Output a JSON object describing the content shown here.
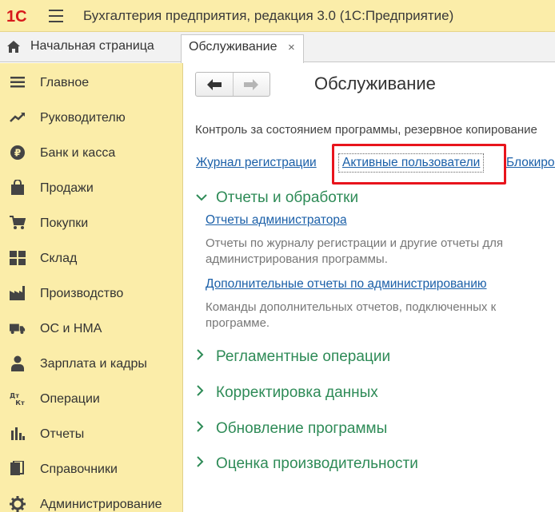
{
  "app": {
    "logo_text": "1С",
    "title": "Бухгалтерия предприятия, редакция 3.0   (1С:Предприятие)"
  },
  "tabs": {
    "home_label": "Начальная страница",
    "active_label": "Обслуживание",
    "close_glyph": "×"
  },
  "sidebar": {
    "items": [
      {
        "label": "Главное",
        "icon": "list-icon"
      },
      {
        "label": "Руководителю",
        "icon": "trend-icon"
      },
      {
        "label": "Банк и касса",
        "icon": "ruble-coin-icon"
      },
      {
        "label": "Продажи",
        "icon": "shopping-bag-icon"
      },
      {
        "label": "Покупки",
        "icon": "cart-icon"
      },
      {
        "label": "Склад",
        "icon": "warehouse-grid-icon"
      },
      {
        "label": "Производство",
        "icon": "factory-icon"
      },
      {
        "label": "ОС и НМА",
        "icon": "truck-icon"
      },
      {
        "label": "Зарплата и кадры",
        "icon": "person-icon"
      },
      {
        "label": "Операции",
        "icon": "debit-credit-icon"
      },
      {
        "label": "Отчеты",
        "icon": "bar-chart-icon"
      },
      {
        "label": "Справочники",
        "icon": "books-icon"
      },
      {
        "label": "Администрирование",
        "icon": "gear-icon"
      }
    ]
  },
  "main": {
    "title": "Обслуживание",
    "description": "Контроль за состоянием программы, резервное копирование",
    "links": {
      "journal": "Журнал регистрации",
      "active_users": "Активные пользователи",
      "blocking": "Блокировка"
    },
    "sections": [
      {
        "label": "Отчеты и обработки",
        "expanded": true,
        "items": [
          {
            "link": "Отчеты администратора",
            "desc_line1": "Отчеты по журналу регистрации и другие отчеты для",
            "desc_line2": "администрирования программы."
          },
          {
            "link": "Дополнительные отчеты по администрированию",
            "desc_line1": "Команды дополнительных отчетов, подключенных к",
            "desc_line2": "программе."
          }
        ]
      },
      {
        "label": "Регламентные операции",
        "expanded": false
      },
      {
        "label": "Корректировка данных",
        "expanded": false
      },
      {
        "label": "Обновление программы",
        "expanded": false
      },
      {
        "label": "Оценка производительности",
        "expanded": false
      }
    ]
  },
  "colors": {
    "header_bg": "#fbeda9",
    "sidebar_bg": "#fbeda9",
    "link": "#1a5fa8",
    "section": "#2e8b57",
    "highlight": "#e8141c",
    "logo": "#d7191c"
  }
}
